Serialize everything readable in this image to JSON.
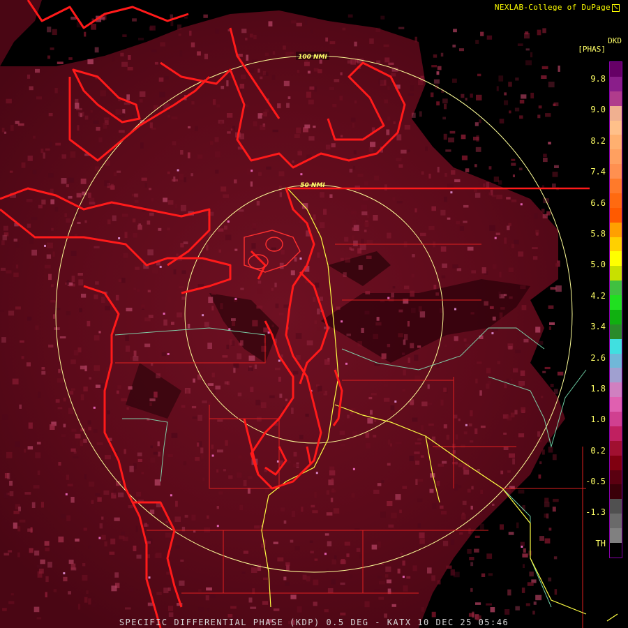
{
  "credit": "NEXLAB-College of DuPage",
  "credit_icon": "external-link-icon",
  "caption": "SPECIFIC DIFFERENTIAL PHASE (KDP) 0.5 DEG - KATX 10 DEC 25 05:46",
  "legend": {
    "product": "DKD",
    "unit": "[PHAS]",
    "labels": [
      "9.8",
      "9.0",
      "8.2",
      "7.4",
      "6.6",
      "5.8",
      "5.0",
      "4.2",
      "3.4",
      "2.6",
      "1.8",
      "1.0",
      "0.2",
      "-0.5",
      "-1.3",
      "TH"
    ],
    "colors": [
      "#660066",
      "#8a1e8a",
      "#b03c8c",
      "#f0b090",
      "#ffc08a",
      "#ffb070",
      "#ffa060",
      "#ff9050",
      "#ff7a2a",
      "#ff6a10",
      "#ff5a00",
      "#ffa000",
      "#ffd000",
      "#ffff00",
      "#c8e000",
      "#40c040",
      "#20e020",
      "#10b010",
      "#2a8a2a",
      "#40e0e0",
      "#70b8d8",
      "#a0a0d0",
      "#d080c0",
      "#e060b0",
      "#d04090",
      "#c02060",
      "#a01030",
      "#800010",
      "#5a0010",
      "#3a0008",
      "#505050",
      "#6a6a6a",
      "#808080",
      "#000000"
    ]
  },
  "range_rings": [
    "100 NMI",
    "50 NMI"
  ],
  "colors": {
    "background": "#000000",
    "echo_base": "#5c0a1a",
    "echo_light": "#7a1428",
    "coast": "#ff1a1a",
    "ring": "#ffff99",
    "highway": "#ffff44",
    "river": "#88ffcc"
  }
}
